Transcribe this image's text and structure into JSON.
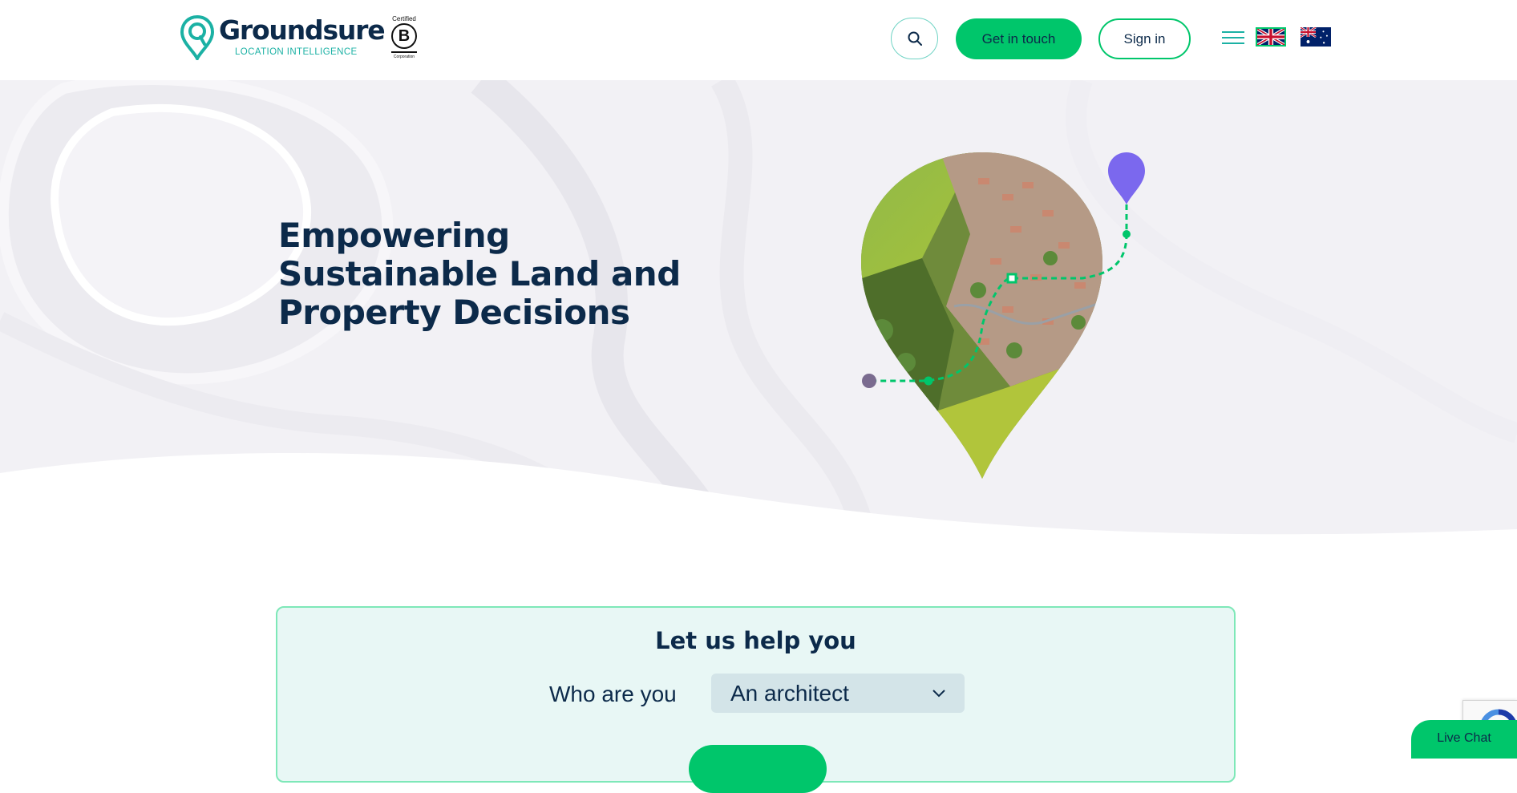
{
  "header": {
    "brand_name": "Groundsure",
    "brand_tagline": "LOCATION INTELLIGENCE",
    "bcorp_certified": "Certified",
    "bcorp_letter": "B",
    "bcorp_corporation": "Corporation",
    "get_in_touch": "Get in touch",
    "sign_in": "Sign in",
    "flags": [
      "uk-flag",
      "australia-flag"
    ]
  },
  "hero": {
    "title": "Empowering Sustainable Land and Property Decisions"
  },
  "help": {
    "title": "Let us help you",
    "who_label": "Who are you",
    "who_value": "An architect"
  },
  "widgets": {
    "live_chat": "Live Chat"
  },
  "colors": {
    "navy": "#0c2a4a",
    "green": "#00c66b",
    "teal": "#1bb1a4",
    "purple": "#7b68ee",
    "hero_bg": "#f2f1f5",
    "help_bg": "#e8f7f5"
  }
}
